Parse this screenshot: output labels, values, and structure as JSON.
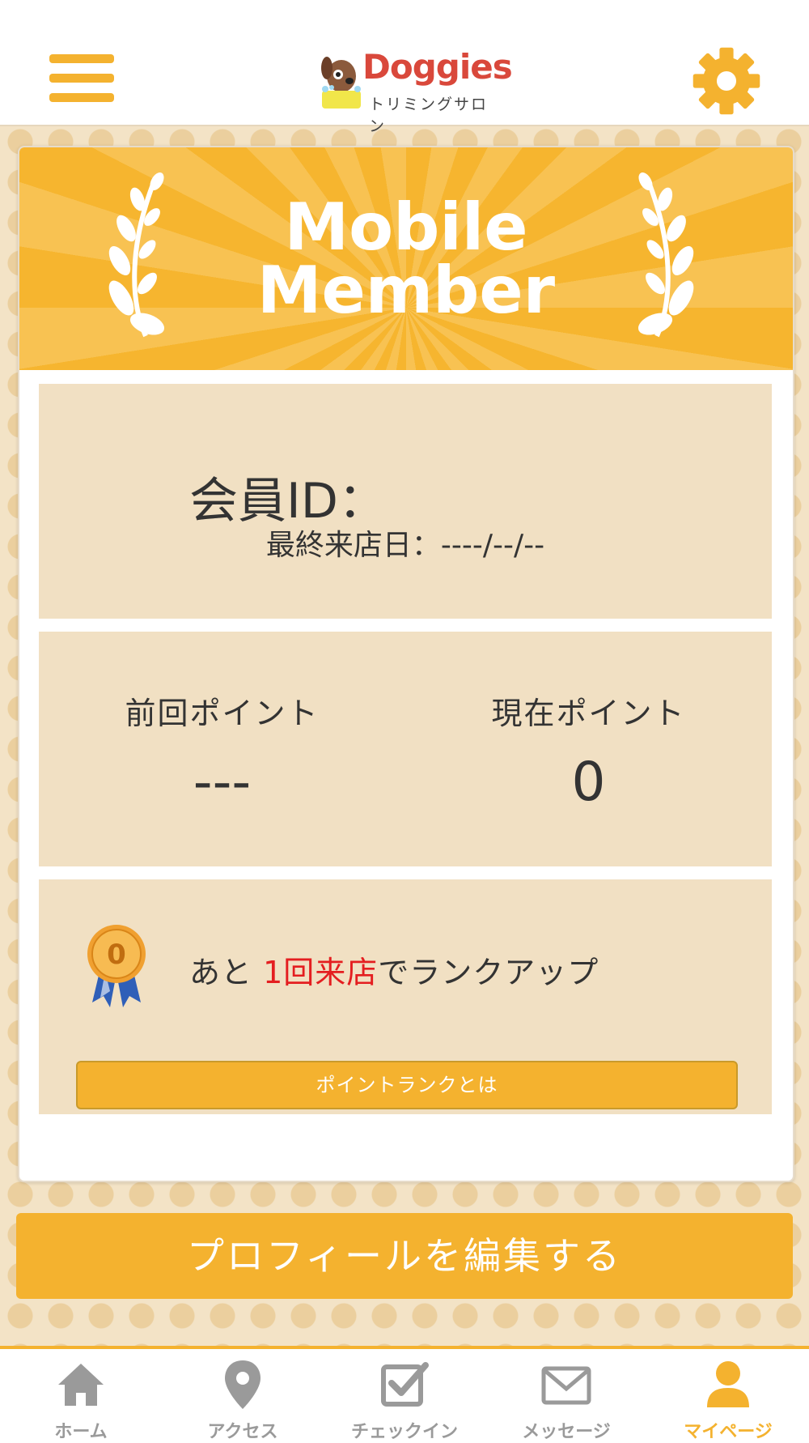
{
  "header": {
    "logo_text": "Doggies",
    "logo_subtitle": "トリミングサロン",
    "menu_icon": "hamburger-menu-icon",
    "settings_icon": "gear-icon"
  },
  "card": {
    "banner_line1": "Mobile",
    "banner_line2": "Member",
    "member_id_label": "会員ID：",
    "last_visit_label": "最終来店日：----/--/--",
    "previous_points_label": "前回ポイント",
    "previous_points_value": "---",
    "current_points_label": "現在ポイント",
    "current_points_value": "0",
    "rank": {
      "medal_number": "0",
      "message_prefix": "あと ",
      "message_highlight": "1回来店",
      "message_suffix": "でランクアップ",
      "button_label": "ポイントランクとは"
    }
  },
  "edit_profile_label": "プロフィールを編集する",
  "tabs": [
    {
      "label": "ホーム",
      "icon": "home-icon",
      "active": false
    },
    {
      "label": "アクセス",
      "icon": "map-pin-icon",
      "active": false
    },
    {
      "label": "チェックイン",
      "icon": "checkbox-icon",
      "active": false
    },
    {
      "label": "メッセージ",
      "icon": "envelope-icon",
      "active": false
    },
    {
      "label": "マイページ",
      "icon": "user-icon",
      "active": true
    }
  ],
  "colors": {
    "accent": "#f4b22f",
    "panel": "#f1e0c3",
    "highlight": "#e41e20",
    "logo": "#d9483b",
    "tab_inactive": "#9a9a9a"
  }
}
